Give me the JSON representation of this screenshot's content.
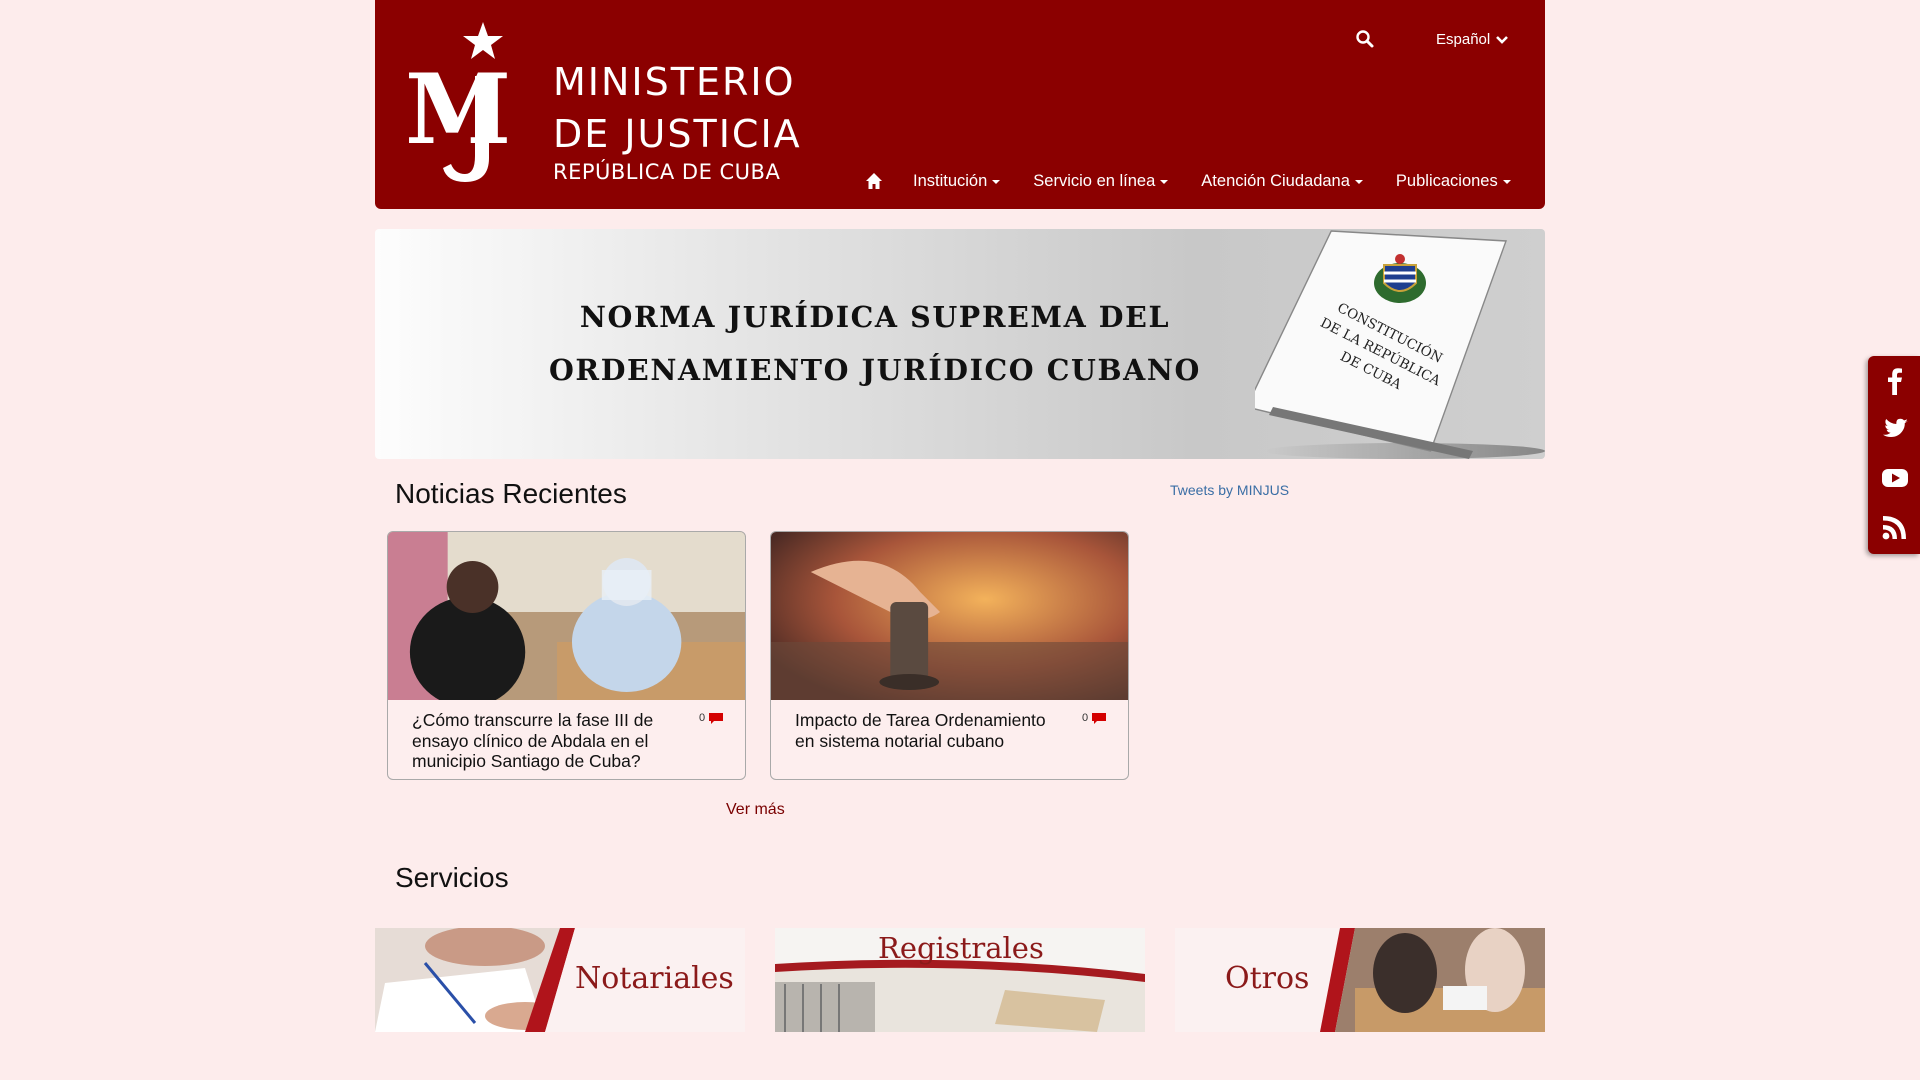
{
  "header": {
    "logo_line_1": "MINISTERIO",
    "logo_line_2": "DE JUSTICIA",
    "logo_line_3": "REPÚBLICA DE CUBA",
    "language": "Español",
    "nav": [
      "Institución",
      "Servicio en línea",
      "Atención Ciudadana",
      "Publicaciones"
    ]
  },
  "banner": {
    "line_1": "NORMA JURÍDICA SUPREMA DEL",
    "line_2": "ORDENAMIENTO JURÍDICO CUBANO",
    "book_text": "CONSTITUCIÓN DE LA REPÚBLICA DE CUBA"
  },
  "news": {
    "title": "Noticias Recientes",
    "tweets_link": "Tweets by MINJUS",
    "items": [
      {
        "title": "¿Cómo transcurre la fase III de ensayo clínico de Abdala en el municipio Santiago de Cuba?",
        "comments": "0"
      },
      {
        "title": "Impacto de Tarea Ordenamiento en sistema notarial cubano",
        "comments": "0"
      }
    ],
    "more": "Ver más"
  },
  "services": {
    "title": "Servicios",
    "items": [
      "Notariales",
      "Registrales",
      "Otros"
    ]
  },
  "colors": {
    "brand": "#8b0000",
    "page_background": "#fdecec",
    "link": "#3a6ea5"
  },
  "social": [
    "facebook-icon",
    "twitter-icon",
    "youtube-icon",
    "rss-icon"
  ]
}
